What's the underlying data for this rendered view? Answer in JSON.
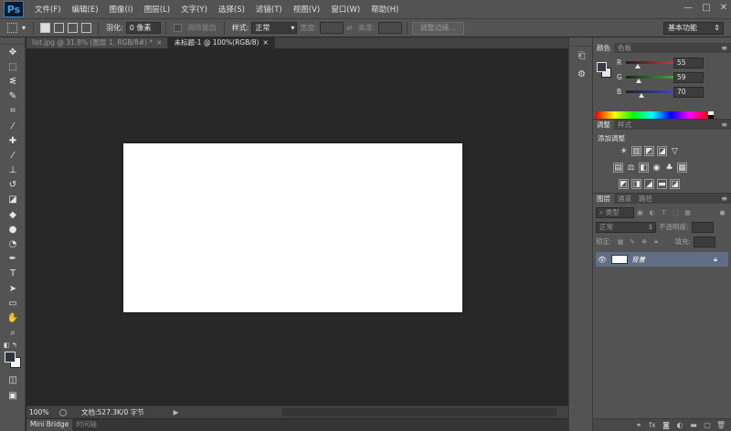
{
  "app": {
    "logo": "Ps"
  },
  "menu": [
    "文件(F)",
    "编辑(E)",
    "图像(I)",
    "图层(L)",
    "文字(Y)",
    "选择(S)",
    "滤镜(T)",
    "视图(V)",
    "窗口(W)",
    "帮助(H)"
  ],
  "window_controls": [
    "—",
    "□",
    "✕"
  ],
  "options": {
    "feather_label": "羽化:",
    "feather_value": "0 像素",
    "antialias_label": "消除锯齿",
    "style_label": "样式:",
    "style_value": "正常",
    "width_label": "宽度:",
    "height_label": "高度:",
    "refine_edge_button": "调整边缘...",
    "workspace": "基本功能"
  },
  "doc_tabs": [
    {
      "label": "list.jpg @ 31.8% (图层 1, RGB/8#) *",
      "active": false
    },
    {
      "label": "未标题-1 @ 100%(RGB/8)",
      "active": true
    }
  ],
  "status": {
    "zoom": "100%",
    "doc_info": "文档:527.3K/0 字节"
  },
  "bottom_tabs": [
    {
      "label": "Mini Bridge",
      "active": true
    },
    {
      "label": "时间轴",
      "active": false
    }
  ],
  "color_panel": {
    "tabs": [
      "颜色",
      "色板"
    ],
    "channels": [
      {
        "name": "R",
        "value": "55",
        "color": "#e04040",
        "fraction": 0.216
      },
      {
        "name": "G",
        "value": "59",
        "color": "#40c040",
        "fraction": 0.231
      },
      {
        "name": "B",
        "value": "70",
        "color": "#4050e0",
        "fraction": 0.275
      }
    ],
    "foreground_color": "#373b46",
    "background_color": "#e6e6e6"
  },
  "adjustments_panel": {
    "tabs": [
      "调整",
      "样式"
    ],
    "title": "添加调整"
  },
  "layers_panel": {
    "tabs": [
      "图层",
      "通道",
      "路径"
    ],
    "filter_kind": "类型",
    "blend_mode": "正常",
    "opacity_label": "不透明度:",
    "lock_label": "锁定:",
    "fill_label": "填充:",
    "layers": [
      {
        "name": "背景",
        "visible": true,
        "locked": true
      }
    ]
  }
}
